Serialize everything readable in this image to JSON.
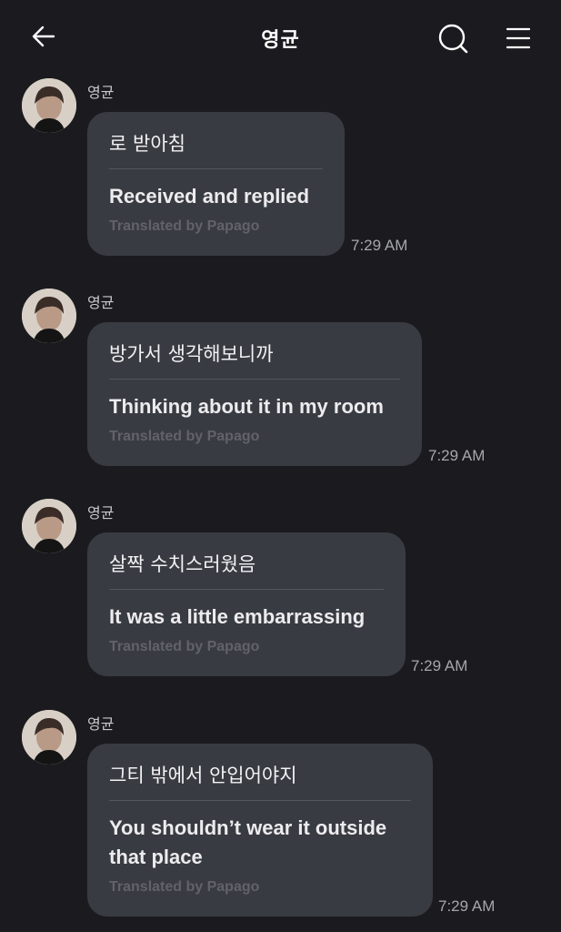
{
  "header": {
    "title": "영균",
    "back_icon": "arrow-left-icon",
    "search_icon": "search-icon",
    "menu_icon": "menu-icon"
  },
  "messages": [
    {
      "sender": "영균",
      "original": "로 받아침",
      "translation": "Received and replied",
      "credit": "Translated by Papago",
      "time": "7:29 AM"
    },
    {
      "sender": "영균",
      "original": "방가서 생각해보니까",
      "translation": "Thinking about it in my room",
      "credit": "Translated by Papago",
      "time": "7:29 AM"
    },
    {
      "sender": "영균",
      "original": "살짝 수치스러웠음",
      "translation": "It was a little embarrassing",
      "credit": "Translated by Papago",
      "time": "7:29 AM"
    },
    {
      "sender": "영균",
      "original": "그티 밖에서 안입어야지",
      "translation": "You shouldn’t wear it outside that place",
      "credit": "Translated by Papago",
      "time": "7:29 AM"
    }
  ],
  "colors": {
    "background": "#1b1b1f",
    "bubble": "#393b42",
    "credit_text": "#616369"
  }
}
